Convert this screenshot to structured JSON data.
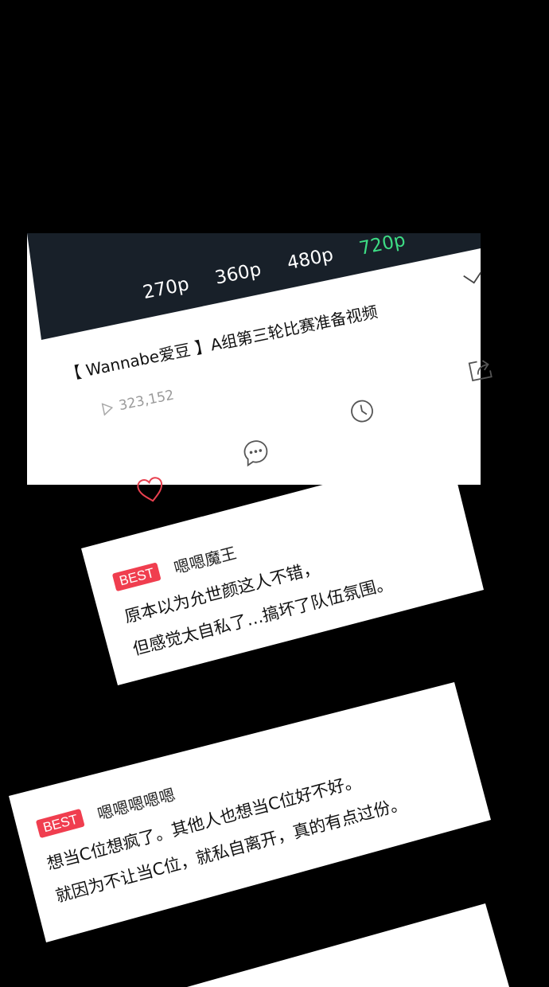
{
  "video": {
    "quality_options": [
      "270p",
      "360p",
      "480p",
      "720p"
    ],
    "active_quality": "720p",
    "title": "【 Wannabe爱豆 】A组第三轮比赛准备视频",
    "view_count": "323,152"
  },
  "comments": [
    {
      "badge": "BEST",
      "user": "嗯嗯魔王",
      "lines": [
        "原本以为允世颜这人不错，",
        "但感觉太自私了…搞坏了队伍氛围。"
      ]
    },
    {
      "badge": "BEST",
      "user": "嗯嗯嗯嗯嗯",
      "lines": [
        "想当C位想疯了。其他人也想当C位好不好。",
        "就因为不让当C位，就私自离开，真的有点过份。"
      ]
    }
  ],
  "colors": {
    "background": "#000000",
    "player": "#182029",
    "active_quality": "#3ddc84",
    "badge": "#f03e4f",
    "heart": "#e8404f"
  }
}
